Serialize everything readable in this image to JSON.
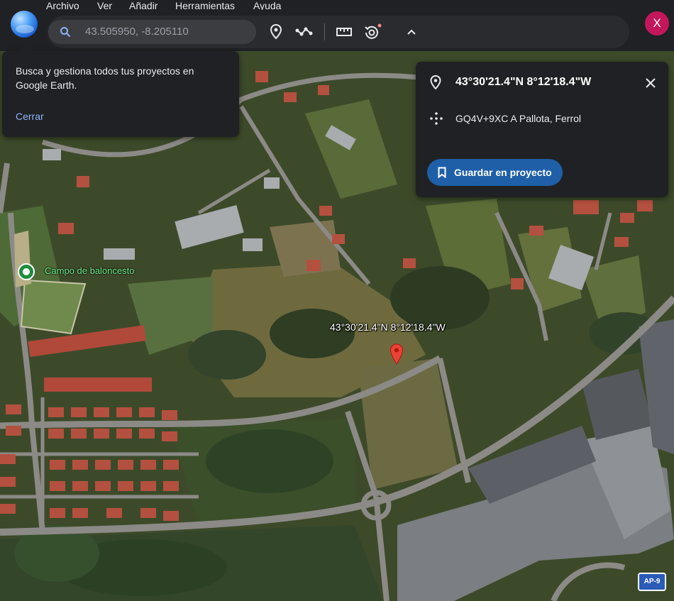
{
  "menu": [
    "Archivo",
    "Ver",
    "Añadir",
    "Herramientas",
    "Ayuda"
  ],
  "search": {
    "value": "43.505950, -8.205110"
  },
  "toolbar": {
    "icons": [
      "place-marker-icon",
      "path-icon",
      "ruler-icon",
      "historical-imagery-icon",
      "chevron-up-icon"
    ]
  },
  "account": {
    "initial": "X",
    "color": "#c2185b"
  },
  "tooltip": {
    "text": "Busca y gestiona todos tus proyectos en Google Earth.",
    "close_label": "Cerrar"
  },
  "place_card": {
    "coordinates": "43°30'21.4\"N 8°12'18.4\"W",
    "plus_code": "GQ4V+9XC A Pallota, Ferrol",
    "save_label": "Guardar en proyecto"
  },
  "map": {
    "poi_label": "Campo de baloncesto",
    "pin_label": "43°30'21.4\"N 8°12'18.4\"W",
    "road_shield": "AP-9",
    "pin_color": "#ea4335"
  },
  "colors": {
    "accent": "#8ab4f8",
    "button": "#1e5fa8",
    "ui_background": "#202124"
  }
}
